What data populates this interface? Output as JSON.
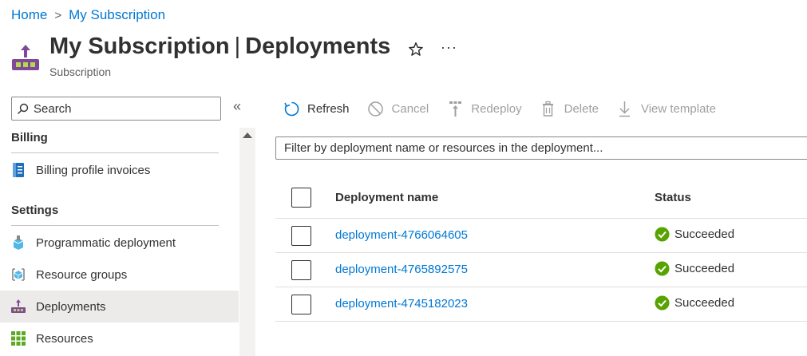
{
  "breadcrumb": {
    "home": "Home",
    "separator": ">",
    "current": "My Subscription"
  },
  "header": {
    "title_strong": "My Subscription",
    "title_separator": "|",
    "title_page": "Deployments",
    "subtitle": "Subscription",
    "favorite_icon": "star-icon",
    "more_label": "···"
  },
  "sidebar": {
    "search_placeholder": "Search",
    "collapse_label": "«",
    "sections": [
      {
        "title": "Billing"
      },
      {
        "title": "Settings"
      }
    ],
    "items": [
      {
        "label": "Billing profile invoices",
        "icon": "invoice-icon"
      },
      {
        "label": "Programmatic deployment",
        "icon": "programmatic-deployment-icon"
      },
      {
        "label": "Resource groups",
        "icon": "resource-groups-icon"
      },
      {
        "label": "Deployments",
        "icon": "deployments-icon",
        "active": true
      },
      {
        "label": "Resources",
        "icon": "resources-grid-icon"
      }
    ]
  },
  "toolbar": {
    "refresh": "Refresh",
    "cancel": "Cancel",
    "redeploy": "Redeploy",
    "delete": "Delete",
    "view_template": "View template"
  },
  "filter": {
    "placeholder": "Filter by deployment name or resources in the deployment..."
  },
  "table": {
    "columns": [
      "Deployment name",
      "Status"
    ],
    "rows": [
      {
        "name": "deployment-4766064605",
        "status": "Succeeded"
      },
      {
        "name": "deployment-4765892575",
        "status": "Succeeded"
      },
      {
        "name": "deployment-4745182023",
        "status": "Succeeded"
      }
    ]
  },
  "colors": {
    "link": "#0078d4",
    "success": "#57a300",
    "active_bg": "#edebe9",
    "brand_purple": "#804998"
  }
}
